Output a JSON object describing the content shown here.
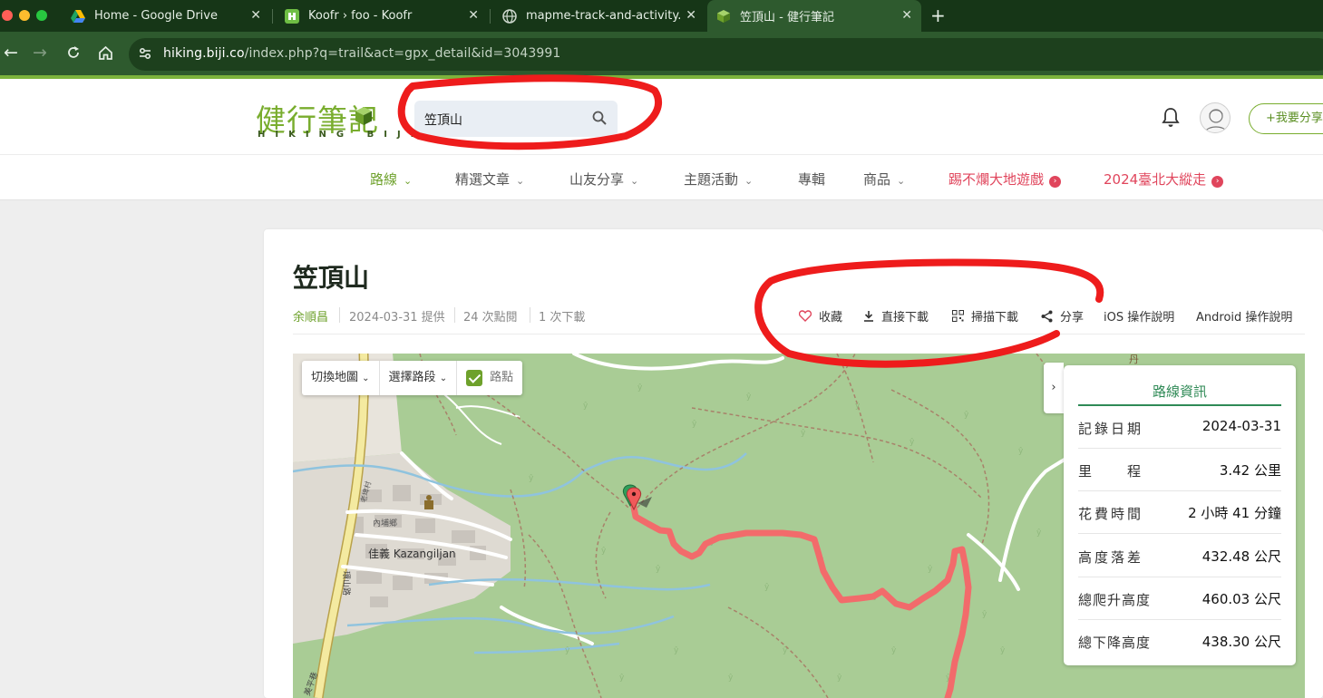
{
  "browser": {
    "tabs": [
      {
        "title": "Home - Google Drive"
      },
      {
        "title": "Koofr › foo - Koofr"
      },
      {
        "title": "mapme-track-and-activity.pn"
      },
      {
        "title": "笠頂山 - 健行筆記"
      }
    ],
    "url_host": "hiking.biji.co",
    "url_path": "/index.php?q=trail&act=gpx_detail&id=3043991"
  },
  "site": {
    "logo_cn": "健行筆記",
    "logo_en": "HIKING BIJI",
    "search_value": "笠頂山",
    "share_button": "+我要分享"
  },
  "nav": {
    "items": [
      {
        "label": "路線"
      },
      {
        "label": "精選文章"
      },
      {
        "label": "山友分享"
      },
      {
        "label": "主題活動"
      },
      {
        "label": "專輯"
      },
      {
        "label": "商品"
      },
      {
        "label": "踢不爛大地遊戲"
      },
      {
        "label": "2024臺北大縱走"
      }
    ]
  },
  "trail": {
    "title": "笠頂山",
    "author": "余順昌",
    "date": "2024-03-31 提供",
    "views": "24 次點閱",
    "downloads": "1 次下載",
    "actions": {
      "favorite": "收藏",
      "download": "直接下載",
      "scan": "掃描下載",
      "share": "分享",
      "ios": "iOS 操作說明",
      "android": "Android 操作說明"
    }
  },
  "map": {
    "switch_map": "切換地圖",
    "select_segment": "選擇路段",
    "waypoints": "路點",
    "waypoints_checked": true,
    "labels": {
      "village": "佳義 Kazangiljan",
      "road1": "內埔鄉",
      "road2": "老埤村",
      "road3": "環山路",
      "road4": "美平巷"
    },
    "colors": {
      "forest": "#a9cc95",
      "track": "#f26b6b"
    }
  },
  "route_info": {
    "title": "路線資訊",
    "rows": [
      {
        "label": "記錄日期",
        "value": "2024-03-31"
      },
      {
        "label": "里　　程",
        "value": "3.42 公里"
      },
      {
        "label": "花費時間",
        "value": "2 小時 41 分鐘"
      },
      {
        "label": "高度落差",
        "value": "432.48 公尺"
      },
      {
        "label": "總爬升高度",
        "value": "460.03 公尺"
      },
      {
        "label": "總下降高度",
        "value": "438.30 公尺"
      }
    ]
  }
}
